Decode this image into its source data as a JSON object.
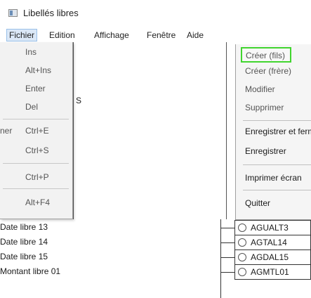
{
  "window": {
    "title": "Libellés libres"
  },
  "menubar": [
    {
      "label": "Fichier",
      "open": true
    },
    {
      "label": "Edition"
    },
    {
      "label": "Affichage"
    },
    {
      "label": "Fenêtre"
    },
    {
      "label": "Aide"
    }
  ],
  "shortcuts": [
    {
      "key": "Ins"
    },
    {
      "key": "Alt+Ins"
    },
    {
      "key": "Enter"
    },
    {
      "key": "Del"
    },
    {
      "key": "Ctrl+E"
    },
    {
      "key": "Ctrl+S"
    },
    {
      "key": "Ctrl+P"
    },
    {
      "key": "Alt+F4"
    }
  ],
  "left_fragments": {
    "row5_prefix": "ner",
    "row3_suffix": "S"
  },
  "context_menu": [
    {
      "label": "Créer (fils)",
      "highlighted": true
    },
    {
      "label": "Créer (frère)"
    },
    {
      "label": "Modifier"
    },
    {
      "label": "Supprimer"
    },
    {
      "label": "Enregistrer et fermer"
    },
    {
      "label": "Enregistrer"
    },
    {
      "label": "Imprimer écran"
    },
    {
      "label": "Quitter"
    }
  ],
  "list_rows": [
    {
      "label": "Date libre 13"
    },
    {
      "label": "Date libre 14"
    },
    {
      "label": "Date libre 15"
    },
    {
      "label": "Montant libre 01"
    }
  ],
  "tree_nodes": [
    {
      "label": "AGUALT3"
    },
    {
      "label": "AGTAL14"
    },
    {
      "label": "AGDAL15"
    },
    {
      "label": "AGMTL01"
    }
  ],
  "colors": {
    "focus_outline": "#41d52f",
    "menu_open_bg": "#dbe8f7"
  }
}
